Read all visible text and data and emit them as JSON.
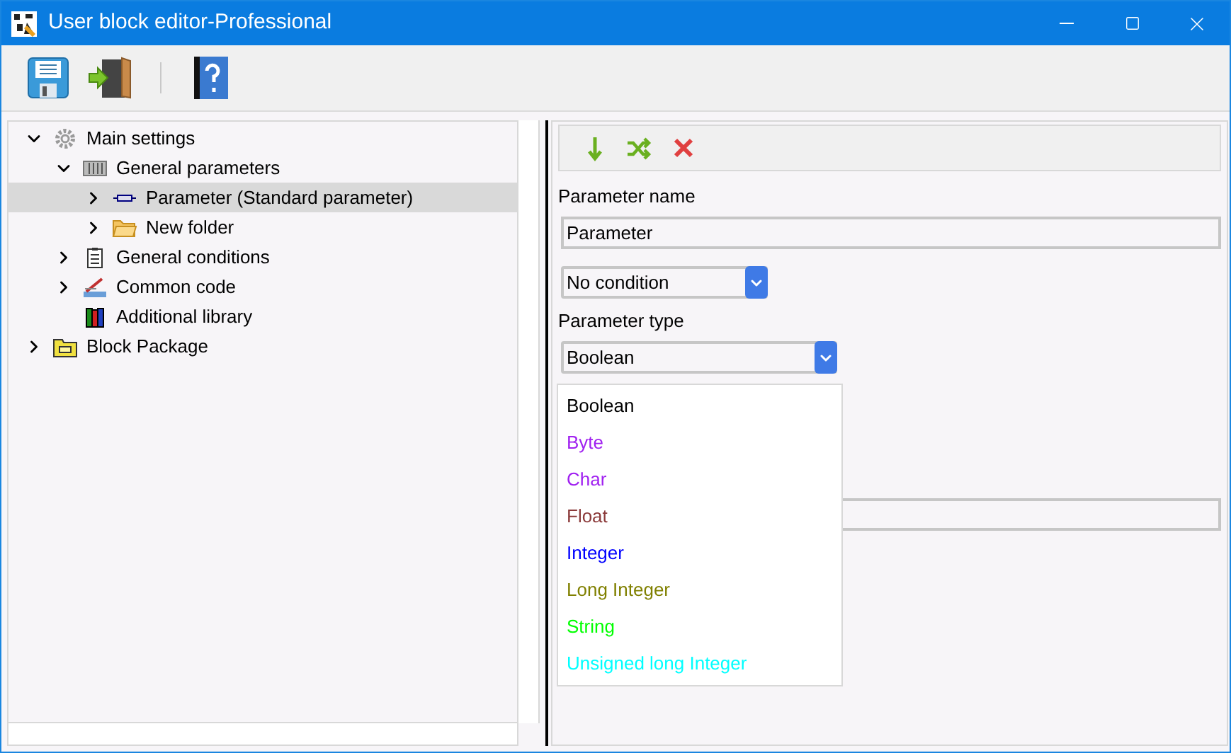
{
  "window": {
    "title": "User block editor-Professional"
  },
  "toolbar": [
    {
      "kind": "save"
    },
    {
      "kind": "exit"
    },
    {
      "kind": "separator"
    },
    {
      "kind": "help"
    }
  ],
  "tree": [
    {
      "label": "Main settings",
      "kind": "gear",
      "expandable": true,
      "expanded": true,
      "selected": false,
      "children": [
        {
          "label": "General parameters",
          "kind": "sliders",
          "expandable": true,
          "expanded": true,
          "selected": false,
          "children": [
            {
              "label": "Parameter (Standard parameter)",
              "kind": "parameter",
              "expandable": true,
              "expanded": false,
              "selected": true
            },
            {
              "label": "New folder",
              "kind": "folder",
              "expandable": true,
              "expanded": false,
              "selected": false
            }
          ]
        },
        {
          "label": "General conditions",
          "kind": "clipboard",
          "expandable": true,
          "expanded": false,
          "selected": false
        },
        {
          "label": "Common code",
          "kind": "code",
          "expandable": true,
          "expanded": false,
          "selected": false
        },
        {
          "label": "Additional library",
          "kind": "books",
          "expandable": false,
          "expanded": false,
          "selected": false
        }
      ]
    },
    {
      "label": "Block Package",
      "kind": "package",
      "expandable": true,
      "expanded": false,
      "selected": false
    }
  ],
  "editor_toolbar": [
    {
      "kind": "down"
    },
    {
      "kind": "shuffle"
    },
    {
      "kind": "delete"
    }
  ],
  "parameter_name": {
    "label": "Parameter name",
    "value": "Parameter"
  },
  "condition_select": {
    "value": "No condition"
  },
  "parameter_type": {
    "label": "Parameter type",
    "value": "Boolean"
  },
  "type_options": [
    {
      "label": "Boolean",
      "color": "#000000"
    },
    {
      "label": "Byte",
      "color": "#a020f0"
    },
    {
      "label": "Char",
      "color": "#a020f0"
    },
    {
      "label": "Float",
      "color": "#8b3a3a"
    },
    {
      "label": "Integer",
      "color": "#0000ff"
    },
    {
      "label": "Long Integer",
      "color": "#808000"
    },
    {
      "label": "String",
      "color": "#00ff00"
    },
    {
      "label": "Unsigned long Integer",
      "color": "#00ffff"
    }
  ]
}
